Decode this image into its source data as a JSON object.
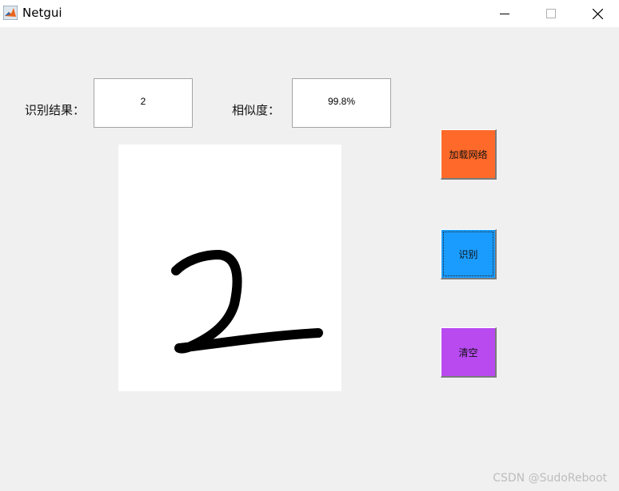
{
  "window": {
    "title": "Netgui",
    "icon": "matlab-icon",
    "controls": {
      "minimize": "minimize-icon",
      "maximize": "maximize-icon",
      "close": "close-icon"
    }
  },
  "result": {
    "label": "识别结果：",
    "value": "2"
  },
  "similarity": {
    "label": "相似度：",
    "value": "99.8%"
  },
  "canvas": {
    "content": "handwritten-digit-drawing"
  },
  "buttons": {
    "load_network": "加载网络",
    "recognize": "识别",
    "clear": "清空"
  },
  "colors": {
    "load_button": "#ff6a2a",
    "recognize_button": "#1a9cff",
    "clear_button": "#b84af0",
    "background": "#f0f0f0"
  },
  "watermark": "CSDN @SudoReboot"
}
